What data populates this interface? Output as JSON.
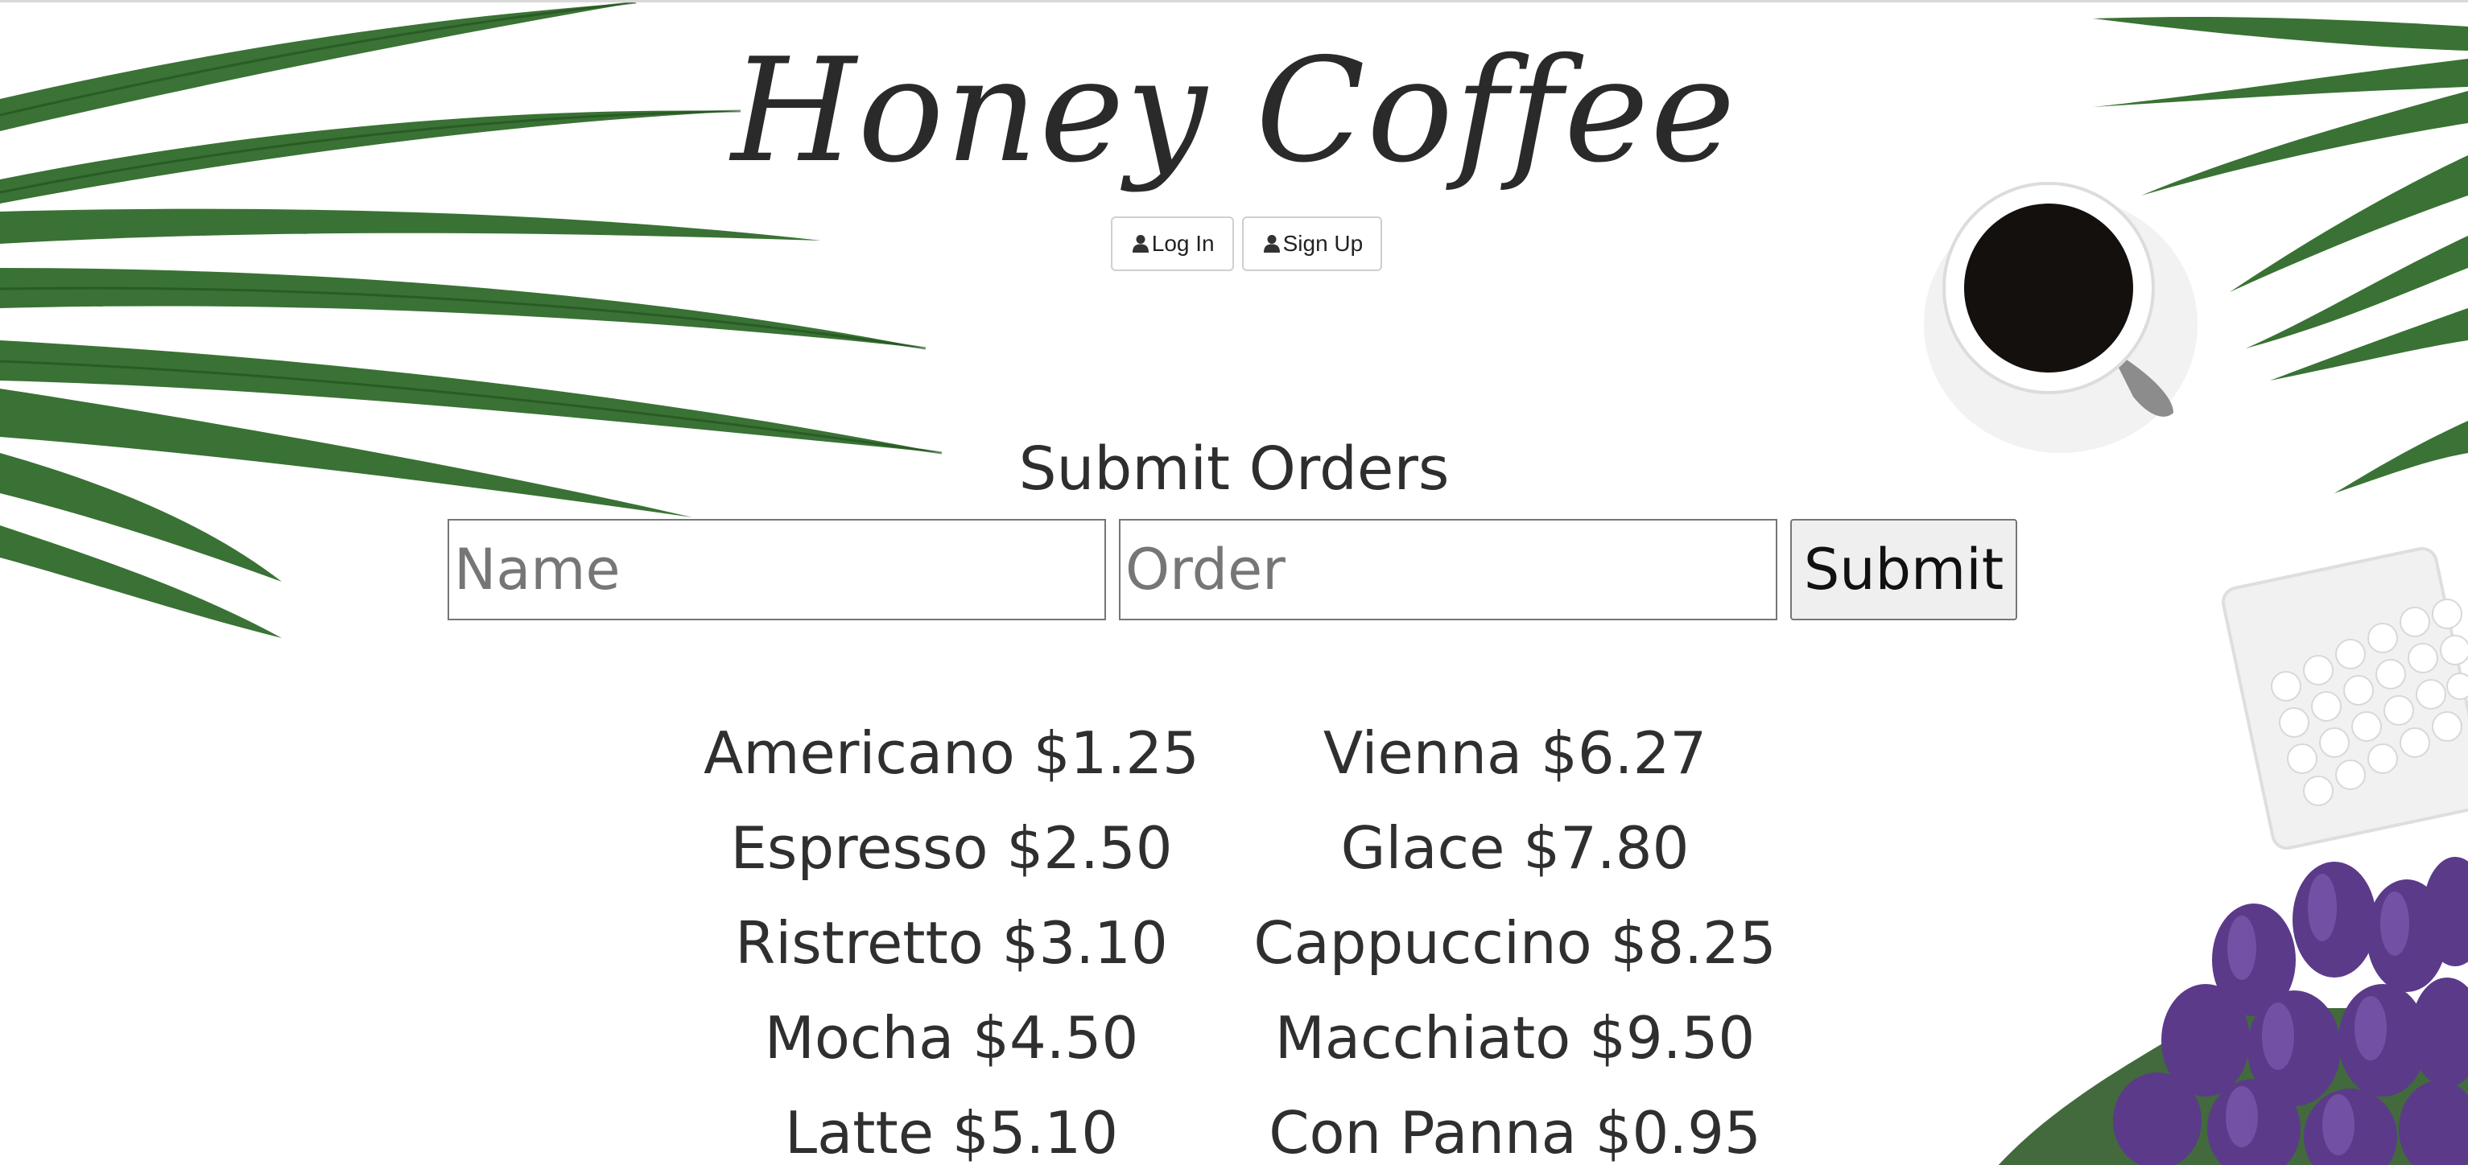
{
  "brand": {
    "title": "Honey Coffee"
  },
  "auth": {
    "login_label": "Log In",
    "signup_label": "Sign Up"
  },
  "orders": {
    "heading": "Submit Orders",
    "name_placeholder": "Name",
    "order_placeholder": "Order",
    "submit_label": "Submit"
  },
  "menu": {
    "left": [
      "Americano $1.25",
      "Espresso $2.50",
      "Ristretto $3.10",
      "Mocha $4.50",
      "Latte $5.10"
    ],
    "right": [
      "Vienna $6.27",
      "Glace $7.80",
      "Cappuccino $8.25",
      "Macchiato $9.50",
      "Con Panna $0.95"
    ]
  },
  "icons": {
    "login": "user-icon",
    "signup": "user-icon"
  },
  "colors": {
    "leaf": "#2f6b2a",
    "leaf_dark": "#1f4d1c",
    "coffee": "#14100d",
    "tulip": "#5b3a8a",
    "text": "#2f2f2f"
  }
}
